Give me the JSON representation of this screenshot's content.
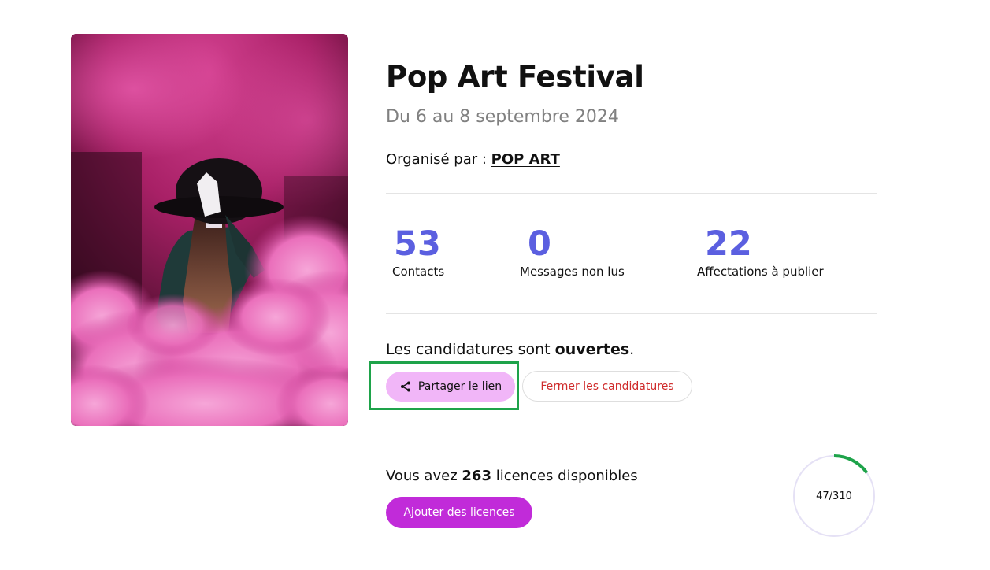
{
  "event": {
    "title": "Pop Art Festival",
    "dates": "Du 6 au 8 septembre 2024",
    "organizer_prefix": "Organisé par :",
    "organizer_name": "POP ART",
    "image_icon": "event-cover-photo"
  },
  "stats": [
    {
      "value": "53",
      "label": "Contacts"
    },
    {
      "value": "0",
      "label": "Messages non lus"
    },
    {
      "value": "22",
      "label": "Affectations à publier"
    }
  ],
  "applications": {
    "status_prefix": "Les candidatures sont",
    "status_value": "ouvertes",
    "status_suffix": ".",
    "share_label": "Partager le lien",
    "share_icon": "share-icon",
    "close_label": "Fermer les candidatures"
  },
  "licences": {
    "text_prefix": "Vous avez",
    "available": "263",
    "text_suffix": "licences disponibles",
    "add_label": "Ajouter des licences",
    "used": 47,
    "total": 310,
    "gauge_label": "47/310"
  },
  "colors": {
    "stat_accent": "#5b5fe0",
    "share_button_bg": "#f1b6f8",
    "add_button_bg": "#c12bd9",
    "close_text": "#cf2a2a",
    "gauge_progress": "#1ea34a",
    "highlight_border": "#1ea34a"
  }
}
